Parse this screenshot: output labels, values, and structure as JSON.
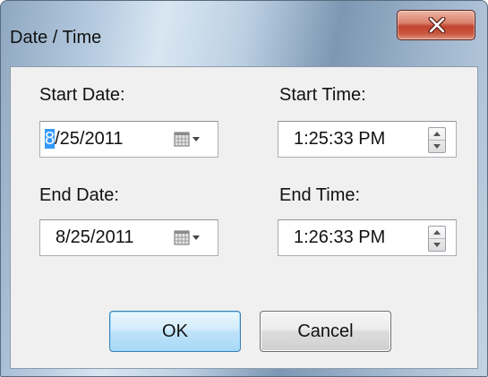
{
  "window": {
    "title": "Date / Time",
    "close_icon": "close-x-icon"
  },
  "start_date": {
    "label": "Start Date:",
    "value_selected": "8",
    "value_rest": "/25/2011",
    "icon": "calendar-dropdown-icon"
  },
  "start_time": {
    "label": "Start Time:",
    "value": "1:25:33 PM",
    "icon": "spin-arrows-icon"
  },
  "end_date": {
    "label": "End Date:",
    "value": "8/25/2011",
    "icon": "calendar-dropdown-icon"
  },
  "end_time": {
    "label": "End Time:",
    "value": "1:26:33 PM",
    "icon": "spin-arrows-icon"
  },
  "buttons": {
    "ok": "OK",
    "cancel": "Cancel"
  },
  "colors": {
    "selection": "#3399ff",
    "close_button": "#c1432e",
    "default_button": "#bfe3f9"
  }
}
